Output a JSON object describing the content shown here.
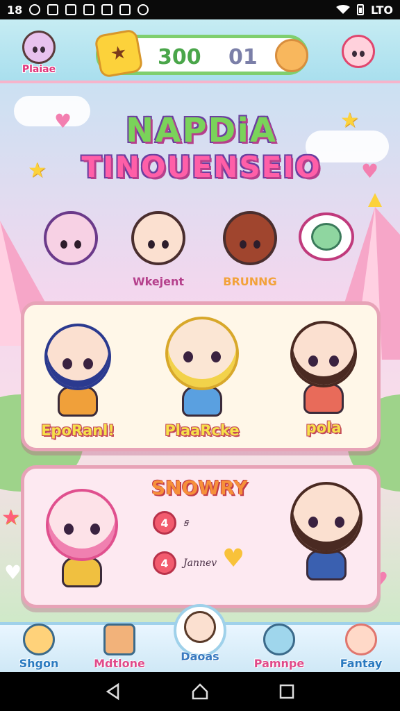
{
  "status_bar": {
    "time": "18",
    "battery_text": "LTO",
    "icons": [
      "notification-icon",
      "app-icon",
      "tools-icon",
      "photo-icon",
      "calendar-icon",
      "navigation-icon",
      "camera-icon",
      "wifi-icon",
      "battery-icon"
    ]
  },
  "hud": {
    "profile_label": "Plaiae",
    "score_left": "300",
    "score_right": "01",
    "colors": {
      "score_left": "#4aa64a",
      "score_right": "#7b7fa8",
      "accent": "#f6b4cb"
    }
  },
  "title": {
    "line1": "NAPDiA",
    "line2": "TINOUENSEIO"
  },
  "mid_characters": [
    {
      "label": "",
      "color": "#6b3a8a"
    },
    {
      "label": "Wkejent",
      "color": "#b5408c"
    },
    {
      "label": "BRUNNG",
      "color": "#f2a23a"
    }
  ],
  "panel1": {
    "characters": [
      {
        "label": "EpoRanl!",
        "hair": "#2b3a8f",
        "body": "#f0a03a"
      },
      {
        "label": "PlaaRcke",
        "hair": "#f2d24a",
        "body": "#5aa0e0"
      },
      {
        "label": "pola",
        "hair": "#4a2a22",
        "body": "#e86b5a"
      }
    ]
  },
  "panel2": {
    "title": "SNOWRY",
    "rows": [
      {
        "badge": "4",
        "text": "ꞩ"
      },
      {
        "badge": "4",
        "text": "Jannev"
      }
    ],
    "characters": [
      {
        "label": "",
        "hair": "#f080b0",
        "body": "#f0c040"
      },
      {
        "label": "",
        "hair": "#4a2a22",
        "body": "#3a60b0"
      }
    ]
  },
  "bottom_nav": [
    {
      "label": "Shgon",
      "color": "#2a7ac0"
    },
    {
      "label": "Mdtlone",
      "color": "#e04a8a"
    },
    {
      "label": "Daoas",
      "color": "#3a7ac0"
    },
    {
      "label": "Pamnpe",
      "color": "#e04a8a"
    },
    {
      "label": "Fantay",
      "color": "#2a7ac0"
    }
  ]
}
